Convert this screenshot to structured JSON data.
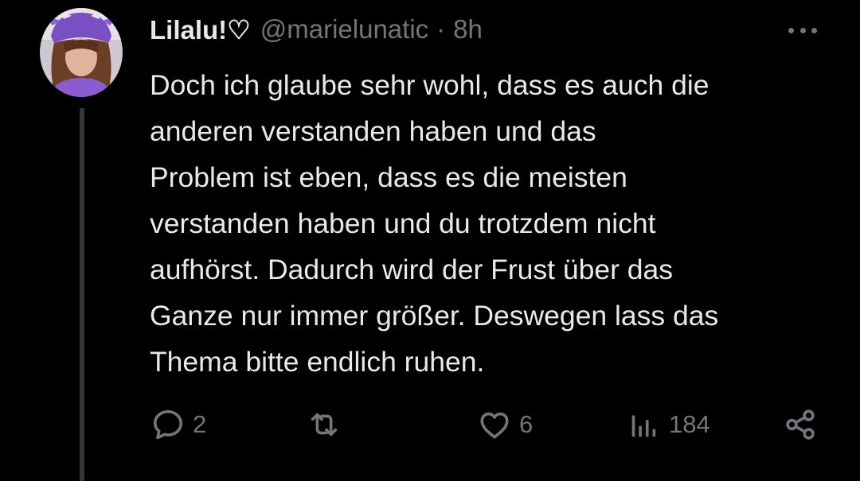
{
  "tweet": {
    "display_name": "Lilalu!♡",
    "handle": "@marielunatic",
    "separator": "·",
    "time": "8h",
    "text": "Doch ich glaube sehr wohl, dass es auch die\nanderen verstanden haben und das\nProblem ist eben, dass es die meisten\nverstanden haben und du trotzdem nicht\naufhörst. Dadurch wird der Frust über das\nGanze nur immer größer. Deswegen lass das\nThema bitte endlich ruhen."
  },
  "actions": {
    "reply_count": "2",
    "retweet_count": "",
    "like_count": "6",
    "views_count": "184"
  },
  "icons": {
    "more": "more-horizontal-icon",
    "reply": "reply-icon",
    "retweet": "retweet-icon",
    "like": "heart-icon",
    "views": "views-chart-icon",
    "share": "share-icon"
  },
  "colors": {
    "background": "#000000",
    "text": "#e7e9ea",
    "secondary": "#71767b",
    "thread_line": "#333639",
    "avatar_accent": "#7b4fc4"
  }
}
